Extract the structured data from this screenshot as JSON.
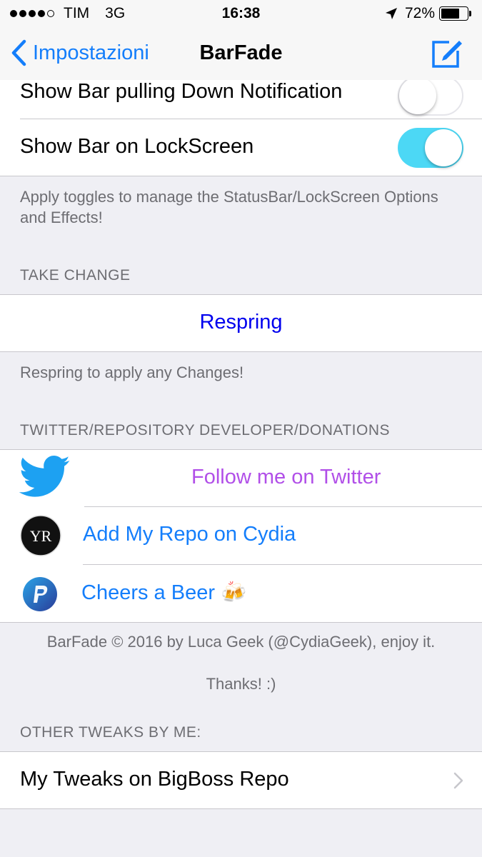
{
  "status_bar": {
    "carrier": "TIM",
    "network": "3G",
    "time": "16:38",
    "battery": "72%",
    "battery_level": 0.72
  },
  "nav": {
    "back_label": "Impostazioni",
    "title": "BarFade"
  },
  "toggles": [
    {
      "label": "Show Bar pulling Down Notification",
      "on": false
    },
    {
      "label": "Show Bar on LockScreen",
      "on": true
    }
  ],
  "toggle_footer": "Apply toggles to manage the StatusBar/LockScreen Options and Effects!",
  "take_change": {
    "header": "TAKE CHANGE",
    "button": "Respring",
    "footer": "Respring to apply any Changes!"
  },
  "links": {
    "header": "TWITTER/REPOSITORY DEVELOPER/DONATIONS",
    "twitter": "Follow me on Twitter",
    "repo": "Add My Repo on Cydia",
    "repo_logo_text": "YR",
    "beer": "Cheers a Beer 🍻"
  },
  "credits": {
    "line1": "BarFade © 2016 by Luca Geek (@CydiaGeek), enjoy it.",
    "line2": "Thanks! :)"
  },
  "other": {
    "header": "OTHER TWEAKS BY ME:",
    "item": "My Tweaks on BigBoss Repo"
  },
  "colors": {
    "accent": "#147efb",
    "respring": "#0000ee",
    "twitter_label": "#b14fe8",
    "toggle_on": "#4cd8f5",
    "twitter_blue": "#1da1f2"
  }
}
